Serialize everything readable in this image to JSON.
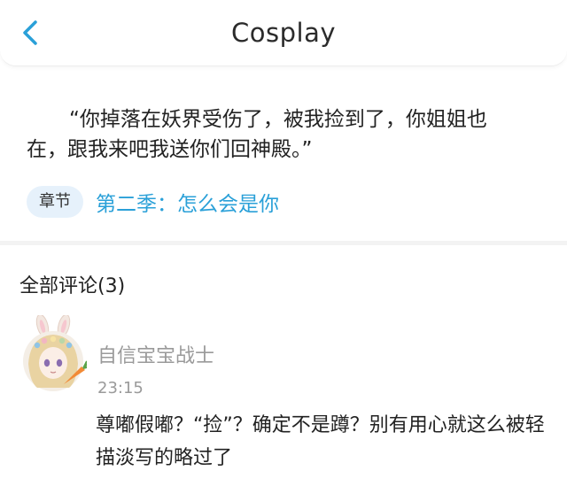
{
  "header": {
    "title": "Cosplay",
    "back_icon": "chevron-left-icon",
    "accent": "#2aa0d8"
  },
  "excerpt": {
    "quote": "“你掉落在妖界受伤了，被我捡到了，你姐姐也在，跟我来吧我送你们回神殿。”",
    "chapter_tag": "章节",
    "chapter_title": "第二季：怎么会是你"
  },
  "comments": {
    "heading": "全部评论(3)",
    "items": [
      {
        "user": "自信宝宝战士",
        "time": "23:15",
        "text": "尊嘟假嘟？“捡”？确定不是蹲？别有用心就这么被轻描淡写的略过了"
      }
    ]
  }
}
